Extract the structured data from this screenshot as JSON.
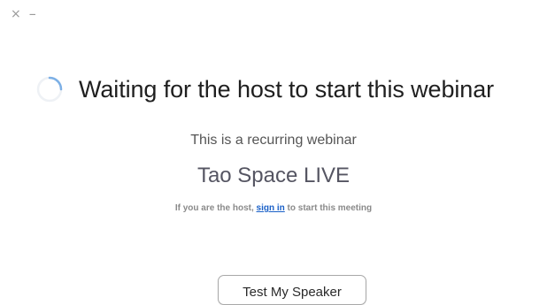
{
  "window": {
    "close_glyph": "×",
    "minimize_glyph": "–"
  },
  "status": {
    "spinner_icon": "loading-spinner-icon",
    "headline": "Waiting for the host to start this webinar",
    "recurring_text": "This is a recurring webinar",
    "webinar_name": "Tao Space LIVE",
    "host_note_prefix": "If you are the host, ",
    "sign_in_link": "sign in",
    "host_note_suffix": " to start this meeting"
  },
  "actions": {
    "test_speaker_label": "Test My Speaker"
  },
  "colors": {
    "accent_link": "#1a60c8",
    "spinner": "#7db0e6"
  }
}
